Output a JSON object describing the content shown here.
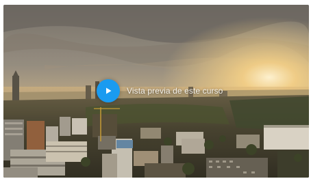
{
  "video": {
    "preview_label": "Vista previa de este curso",
    "play_icon": "play-icon",
    "accent_color": "#1a9bf0"
  }
}
